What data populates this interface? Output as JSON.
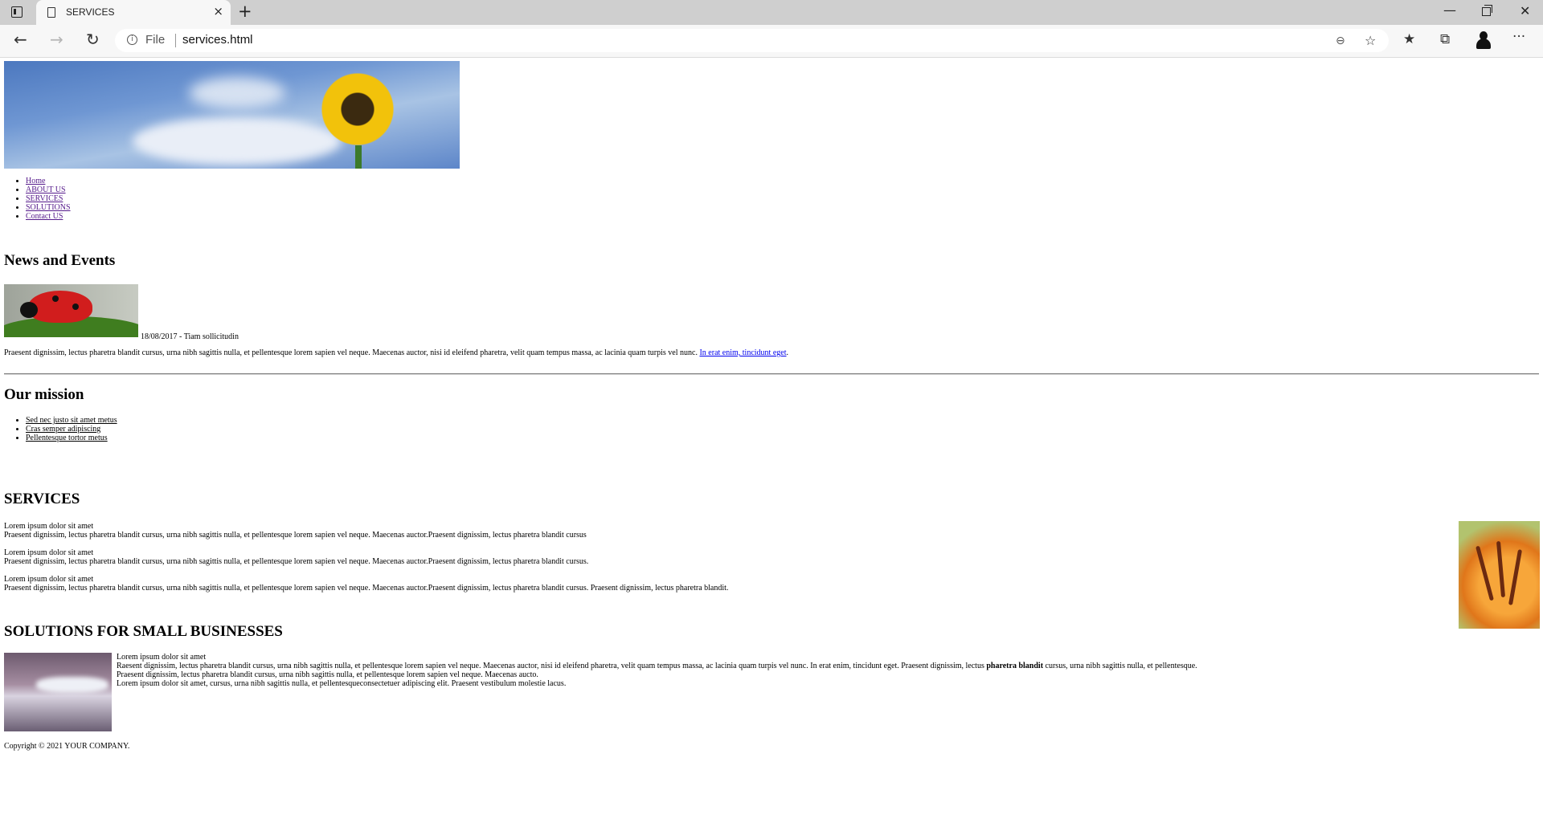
{
  "browser": {
    "tab_title": "SERVICES",
    "new_tab_symbol": "+",
    "close_symbol": "×",
    "address_scheme": "File",
    "address_url": "services.html",
    "info_symbol": "i"
  },
  "header_image_alt": "",
  "nav": {
    "items": [
      "Home",
      "ABOUT US",
      "SERVICES",
      "SOLUTIONS",
      "Contact US"
    ]
  },
  "news": {
    "heading": "News and Events",
    "date_line": "18/08/2017 - Tiam sollicitudin",
    "text": "Praesent dignissim, lectus pharetra blandit cursus, urna nibh sagittis nulla, et pellentesque lorem sapien vel neque. Maecenas auctor, nisi id eleifend pharetra, velit quam tempus massa, ac lacinia quam turpis vel nunc. ",
    "link_text": "In erat enim, tincidunt eget",
    "after_link": "."
  },
  "mission": {
    "heading": "Our mission",
    "items": [
      "Sed nec justo sit amet metus",
      "Cras semper adipiscing",
      "Pellentesque tortor metus"
    ]
  },
  "services": {
    "heading": "SERVICES",
    "items": [
      {
        "title": "Lorem ipsum dolor sit amet",
        "text": "Praesent dignissim, lectus pharetra blandit cursus, urna nibh sagittis nulla, et pellentesque lorem sapien vel neque. Maecenas auctor.Praesent dignissim, lectus pharetra blandit cursus"
      },
      {
        "title": "Lorem ipsum dolor sit amet",
        "text": "Praesent dignissim, lectus pharetra blandit cursus, urna nibh sagittis nulla, et pellentesque lorem sapien vel neque. Maecenas auctor.Praesent dignissim, lectus pharetra blandit cursus."
      },
      {
        "title": "Lorem ipsum dolor sit amet",
        "text": "Praesent dignissim, lectus pharetra blandit cursus, urna nibh sagittis nulla, et pellentesque lorem sapien vel neque. Maecenas auctor.Praesent dignissim, lectus pharetra blandit cursus. Praesent dignissim, lectus pharetra blandit."
      }
    ]
  },
  "solutions": {
    "heading": "SOLUTIONS FOR SMALL BUSINESSES",
    "line1": "Lorem ipsum dolor sit amet",
    "line2_before": "Raesent dignissim, lectus pharetra blandit cursus, urna nibh sagittis nulla, et pellentesque lorem sapien vel neque. Maecenas auctor, nisi id eleifend pharetra, velit quam tempus massa, ac lacinia quam turpis vel nunc. In erat enim, tincidunt eget. Praesent dignissim, lectus ",
    "line2_bold": "pharetra blandit",
    "line2_after": " cursus, urna nibh sagittis nulla, et pellentesque.",
    "line3": "Praesent dignissim, lectus pharetra blandit cursus, urna nibh sagittis nulla, et pellentesque lorem sapien vel neque. Maecenas aucto.",
    "line4": "Lorem ipsum dolor sit amet, cursus, urna nibh sagittis nulla, et pellentesqueconsectetuer adipiscing elit. Praesent vestibulum molestie lacus."
  },
  "footer": {
    "text": "Copyright © 2021 YOUR COMPANY."
  },
  "icons": {
    "back": "back-arrow-icon",
    "forward": "forward-arrow-icon",
    "reload": "reload-icon",
    "zoom": "zoom-out-icon",
    "add_favorite": "add-favorite-icon",
    "favorites": "favorites-icon",
    "collections": "collections-icon",
    "more": "more-icon"
  }
}
